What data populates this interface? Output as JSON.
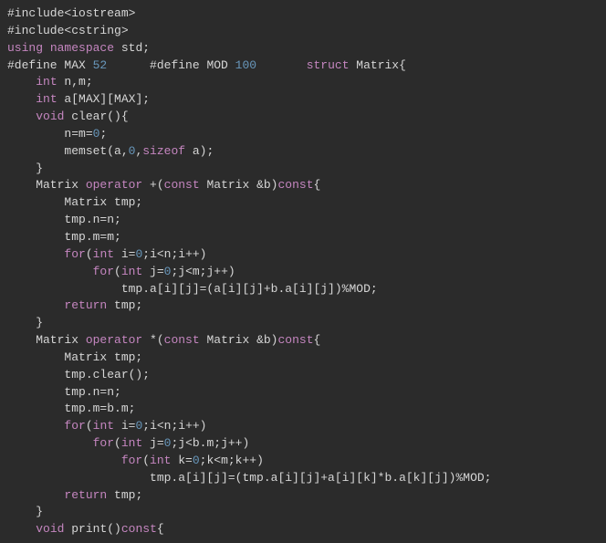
{
  "code": {
    "lines": [
      [
        {
          "t": "#include<iostream>",
          "c": "tok-preproc"
        }
      ],
      [
        {
          "t": "#include<cstring>",
          "c": "tok-preproc"
        }
      ],
      [
        {
          "t": "using",
          "c": "tok-keyword"
        },
        {
          "t": " ",
          "c": "tok-default"
        },
        {
          "t": "namespace",
          "c": "tok-keyword"
        },
        {
          "t": " std;",
          "c": "tok-default"
        }
      ],
      [
        {
          "t": "#define MAX ",
          "c": "tok-preproc"
        },
        {
          "t": "52",
          "c": "tok-number"
        },
        {
          "t": "      #define MOD ",
          "c": "tok-preproc"
        },
        {
          "t": "100",
          "c": "tok-number"
        },
        {
          "t": "       ",
          "c": "tok-default"
        },
        {
          "t": "struct",
          "c": "tok-keyword"
        },
        {
          "t": " Matrix{",
          "c": "tok-default"
        }
      ],
      [
        {
          "t": "    ",
          "c": "tok-default"
        },
        {
          "t": "int",
          "c": "tok-keyword"
        },
        {
          "t": " n,m;",
          "c": "tok-default"
        }
      ],
      [
        {
          "t": "    ",
          "c": "tok-default"
        },
        {
          "t": "int",
          "c": "tok-keyword"
        },
        {
          "t": " a[MAX][MAX];",
          "c": "tok-default"
        }
      ],
      [
        {
          "t": "    ",
          "c": "tok-default"
        },
        {
          "t": "void",
          "c": "tok-keyword"
        },
        {
          "t": " clear(){",
          "c": "tok-default"
        }
      ],
      [
        {
          "t": "        n=m=",
          "c": "tok-default"
        },
        {
          "t": "0",
          "c": "tok-number"
        },
        {
          "t": ";",
          "c": "tok-default"
        }
      ],
      [
        {
          "t": "        memset(a,",
          "c": "tok-default"
        },
        {
          "t": "0",
          "c": "tok-number"
        },
        {
          "t": ",",
          "c": "tok-default"
        },
        {
          "t": "sizeof",
          "c": "tok-keyword"
        },
        {
          "t": " a);",
          "c": "tok-default"
        }
      ],
      [
        {
          "t": "    }",
          "c": "tok-default"
        }
      ],
      [
        {
          "t": "    Matrix ",
          "c": "tok-default"
        },
        {
          "t": "operator",
          "c": "tok-keyword"
        },
        {
          "t": " +(",
          "c": "tok-default"
        },
        {
          "t": "const",
          "c": "tok-keyword"
        },
        {
          "t": " Matrix &b)",
          "c": "tok-default"
        },
        {
          "t": "const",
          "c": "tok-keyword"
        },
        {
          "t": "{",
          "c": "tok-default"
        }
      ],
      [
        {
          "t": "        Matrix tmp;",
          "c": "tok-default"
        }
      ],
      [
        {
          "t": "        tmp.n=n;",
          "c": "tok-default"
        }
      ],
      [
        {
          "t": "        tmp.m=m;",
          "c": "tok-default"
        }
      ],
      [
        {
          "t": "        ",
          "c": "tok-default"
        },
        {
          "t": "for",
          "c": "tok-keyword"
        },
        {
          "t": "(",
          "c": "tok-default"
        },
        {
          "t": "int",
          "c": "tok-keyword"
        },
        {
          "t": " i=",
          "c": "tok-default"
        },
        {
          "t": "0",
          "c": "tok-number"
        },
        {
          "t": ";i<n;i++)",
          "c": "tok-default"
        }
      ],
      [
        {
          "t": "            ",
          "c": "tok-default"
        },
        {
          "t": "for",
          "c": "tok-keyword"
        },
        {
          "t": "(",
          "c": "tok-default"
        },
        {
          "t": "int",
          "c": "tok-keyword"
        },
        {
          "t": " j=",
          "c": "tok-default"
        },
        {
          "t": "0",
          "c": "tok-number"
        },
        {
          "t": ";j<m;j++)",
          "c": "tok-default"
        }
      ],
      [
        {
          "t": "                tmp.a[i][j]=(a[i][j]+b.a[i][j])%MOD;",
          "c": "tok-default"
        }
      ],
      [
        {
          "t": "        ",
          "c": "tok-default"
        },
        {
          "t": "return",
          "c": "tok-keyword"
        },
        {
          "t": " tmp;",
          "c": "tok-default"
        }
      ],
      [
        {
          "t": "    }",
          "c": "tok-default"
        }
      ],
      [
        {
          "t": "    Matrix ",
          "c": "tok-default"
        },
        {
          "t": "operator",
          "c": "tok-keyword"
        },
        {
          "t": " *(",
          "c": "tok-default"
        },
        {
          "t": "const",
          "c": "tok-keyword"
        },
        {
          "t": " Matrix &b)",
          "c": "tok-default"
        },
        {
          "t": "const",
          "c": "tok-keyword"
        },
        {
          "t": "{",
          "c": "tok-default"
        }
      ],
      [
        {
          "t": "        Matrix tmp;",
          "c": "tok-default"
        }
      ],
      [
        {
          "t": "        tmp.clear();",
          "c": "tok-default"
        }
      ],
      [
        {
          "t": "        tmp.n=n;",
          "c": "tok-default"
        }
      ],
      [
        {
          "t": "        tmp.m=b.m;",
          "c": "tok-default"
        }
      ],
      [
        {
          "t": "        ",
          "c": "tok-default"
        },
        {
          "t": "for",
          "c": "tok-keyword"
        },
        {
          "t": "(",
          "c": "tok-default"
        },
        {
          "t": "int",
          "c": "tok-keyword"
        },
        {
          "t": " i=",
          "c": "tok-default"
        },
        {
          "t": "0",
          "c": "tok-number"
        },
        {
          "t": ";i<n;i++)",
          "c": "tok-default"
        }
      ],
      [
        {
          "t": "            ",
          "c": "tok-default"
        },
        {
          "t": "for",
          "c": "tok-keyword"
        },
        {
          "t": "(",
          "c": "tok-default"
        },
        {
          "t": "int",
          "c": "tok-keyword"
        },
        {
          "t": " j=",
          "c": "tok-default"
        },
        {
          "t": "0",
          "c": "tok-number"
        },
        {
          "t": ";j<b.m;j++)",
          "c": "tok-default"
        }
      ],
      [
        {
          "t": "                ",
          "c": "tok-default"
        },
        {
          "t": "for",
          "c": "tok-keyword"
        },
        {
          "t": "(",
          "c": "tok-default"
        },
        {
          "t": "int",
          "c": "tok-keyword"
        },
        {
          "t": " k=",
          "c": "tok-default"
        },
        {
          "t": "0",
          "c": "tok-number"
        },
        {
          "t": ";k<m;k++)",
          "c": "tok-default"
        }
      ],
      [
        {
          "t": "                    tmp.a[i][j]=(tmp.a[i][j]+a[i][k]*b.a[k][j])%MOD;",
          "c": "tok-default"
        }
      ],
      [
        {
          "t": "        ",
          "c": "tok-default"
        },
        {
          "t": "return",
          "c": "tok-keyword"
        },
        {
          "t": " tmp;",
          "c": "tok-default"
        }
      ],
      [
        {
          "t": "    }",
          "c": "tok-default"
        }
      ],
      [
        {
          "t": "    ",
          "c": "tok-default"
        },
        {
          "t": "void",
          "c": "tok-keyword"
        },
        {
          "t": " print()",
          "c": "tok-default"
        },
        {
          "t": "const",
          "c": "tok-keyword"
        },
        {
          "t": "{",
          "c": "tok-default"
        }
      ]
    ]
  }
}
